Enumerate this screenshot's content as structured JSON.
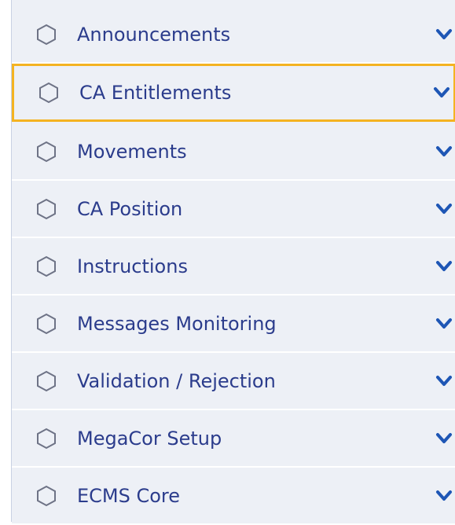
{
  "accent_color": "#f4b321",
  "text_color": "#2b3c8c",
  "items": [
    {
      "label": "Announcements",
      "icon": "hexagon-icon",
      "expand_icon": "chevron-down-icon",
      "highlighted": false
    },
    {
      "label": "CA Entitlements",
      "icon": "hexagon-icon",
      "expand_icon": "chevron-down-icon",
      "highlighted": true
    },
    {
      "label": "Movements",
      "icon": "hexagon-icon",
      "expand_icon": "chevron-down-icon",
      "highlighted": false
    },
    {
      "label": "CA Position",
      "icon": "hexagon-icon",
      "expand_icon": "chevron-down-icon",
      "highlighted": false
    },
    {
      "label": "Instructions",
      "icon": "hexagon-icon",
      "expand_icon": "chevron-down-icon",
      "highlighted": false
    },
    {
      "label": "Messages Monitoring",
      "icon": "hexagon-icon",
      "expand_icon": "chevron-down-icon",
      "highlighted": false
    },
    {
      "label": "Validation / Rejection",
      "icon": "hexagon-icon",
      "expand_icon": "chevron-down-icon",
      "highlighted": false
    },
    {
      "label": "MegaCor Setup",
      "icon": "hexagon-icon",
      "expand_icon": "chevron-down-icon",
      "highlighted": false
    },
    {
      "label": "ECMS Core",
      "icon": "hexagon-icon",
      "expand_icon": "chevron-down-icon",
      "highlighted": false
    }
  ]
}
